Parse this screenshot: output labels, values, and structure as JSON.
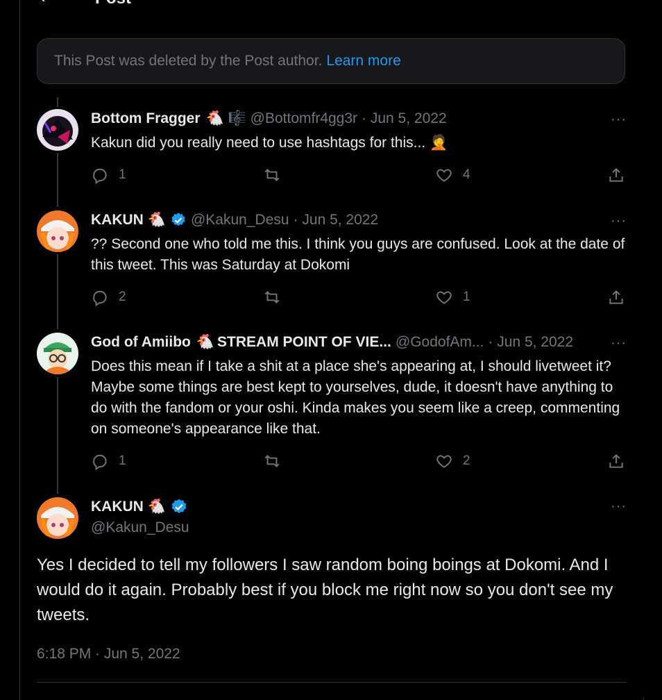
{
  "header": {
    "back_label": "‹",
    "title": "Post"
  },
  "deleted_notice": {
    "text": "This Post was deleted by the Post author.",
    "link": "Learn more"
  },
  "replies": [
    {
      "name": "Bottom Fragger",
      "emoji": "🐔 🎼",
      "handle": "@Bottomfr4gg3r",
      "date": "· Jun 5, 2022",
      "text": "Kakun did you really need to use hashtags for this... 🤦",
      "replies": "1",
      "reposts": "",
      "likes": "4"
    },
    {
      "name": "KAKUN",
      "emoji": "🐔",
      "handle": "@Kakun_Desu",
      "date": "· Jun 5, 2022",
      "text": "?? Second one who told me this. I think you guys are confused. Look at the date of this tweet. This was Saturday at Dokomi",
      "replies": "2",
      "reposts": "",
      "likes": "1"
    },
    {
      "name": "God of Amiibo",
      "emoji": "🐔",
      "name_suffix": "STREAM POINT OF VIE...",
      "handle": "@GodofAm...",
      "date": "· Jun 5, 2022",
      "text": "Does this mean if I take a shit at a place she's appearing at, I should livetweet it? Maybe some things are best kept to yourselves, dude, it doesn't have anything to do with the fandom or your oshi. Kinda makes you seem like a creep, commenting on someone's appearance like that.",
      "replies": "1",
      "reposts": "",
      "likes": "2"
    }
  ],
  "main_post": {
    "name": "KAKUN",
    "emoji": "🐔",
    "handle": "@Kakun_Desu",
    "text": "Yes I decided to tell my followers I saw random boing boings at Dokomi. And I would do it again. Probably best if you block me right now so you don't see my tweets.",
    "timestamp": "6:18 PM · Jun 5, 2022"
  },
  "more_label": "···",
  "colors": {
    "accent": "#1d9bf0",
    "muted": "#71767b",
    "background": "#000000"
  },
  "icons": [
    "back-icon",
    "reply-icon",
    "repost-icon",
    "like-icon",
    "share-icon",
    "more-icon",
    "verified-icon"
  ]
}
